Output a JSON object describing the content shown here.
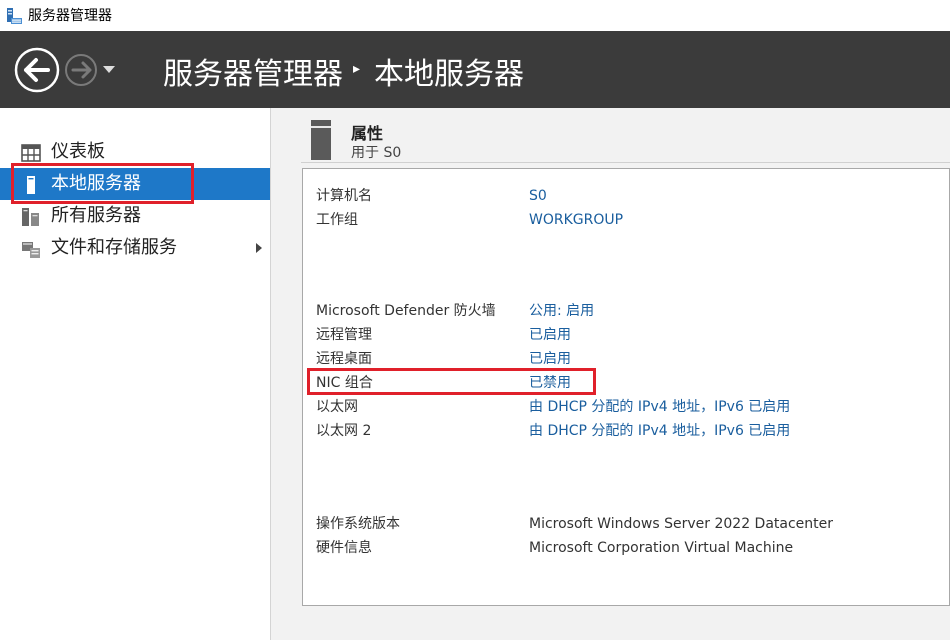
{
  "window": {
    "title": "服务器管理器"
  },
  "header": {
    "breadcrumb_root": "服务器管理器",
    "breadcrumb_separator": "▸",
    "breadcrumb_current": "本地服务器"
  },
  "sidebar": {
    "items": [
      {
        "label": "仪表板",
        "icon": "dashboard-icon"
      },
      {
        "label": "本地服务器",
        "icon": "local-server-icon",
        "active": true
      },
      {
        "label": "所有服务器",
        "icon": "all-servers-icon"
      },
      {
        "label": "文件和存储服务",
        "icon": "file-storage-icon",
        "expandable": true
      }
    ]
  },
  "properties": {
    "title": "属性",
    "subtitle": "用于 S0",
    "group1": [
      {
        "label": "计算机名",
        "value": "S0"
      },
      {
        "label": "工作组",
        "value": "WORKGROUP"
      }
    ],
    "group2": [
      {
        "label": "Microsoft Defender 防火墙",
        "value": "公用: 启用"
      },
      {
        "label": "远程管理",
        "value": "已启用"
      },
      {
        "label": "远程桌面",
        "value": "已启用"
      },
      {
        "label": "NIC 组合",
        "value": "已禁用"
      },
      {
        "label": "以太网",
        "value": "由 DHCP 分配的 IPv4 地址，IPv6 已启用"
      },
      {
        "label": "以太网 2",
        "value": "由 DHCP 分配的 IPv4 地址，IPv6 已启用"
      }
    ],
    "group3": [
      {
        "label": "操作系统版本",
        "value": "Microsoft Windows Server 2022 Datacenter"
      },
      {
        "label": "硬件信息",
        "value": "Microsoft Corporation Virtual Machine"
      }
    ]
  },
  "colors": {
    "header_bg": "#3b3b3b",
    "active_item_bg": "#1e78c8",
    "link": "#1a5e9e",
    "highlight": "#e0202a",
    "main_bg": "#f2f2f2"
  }
}
